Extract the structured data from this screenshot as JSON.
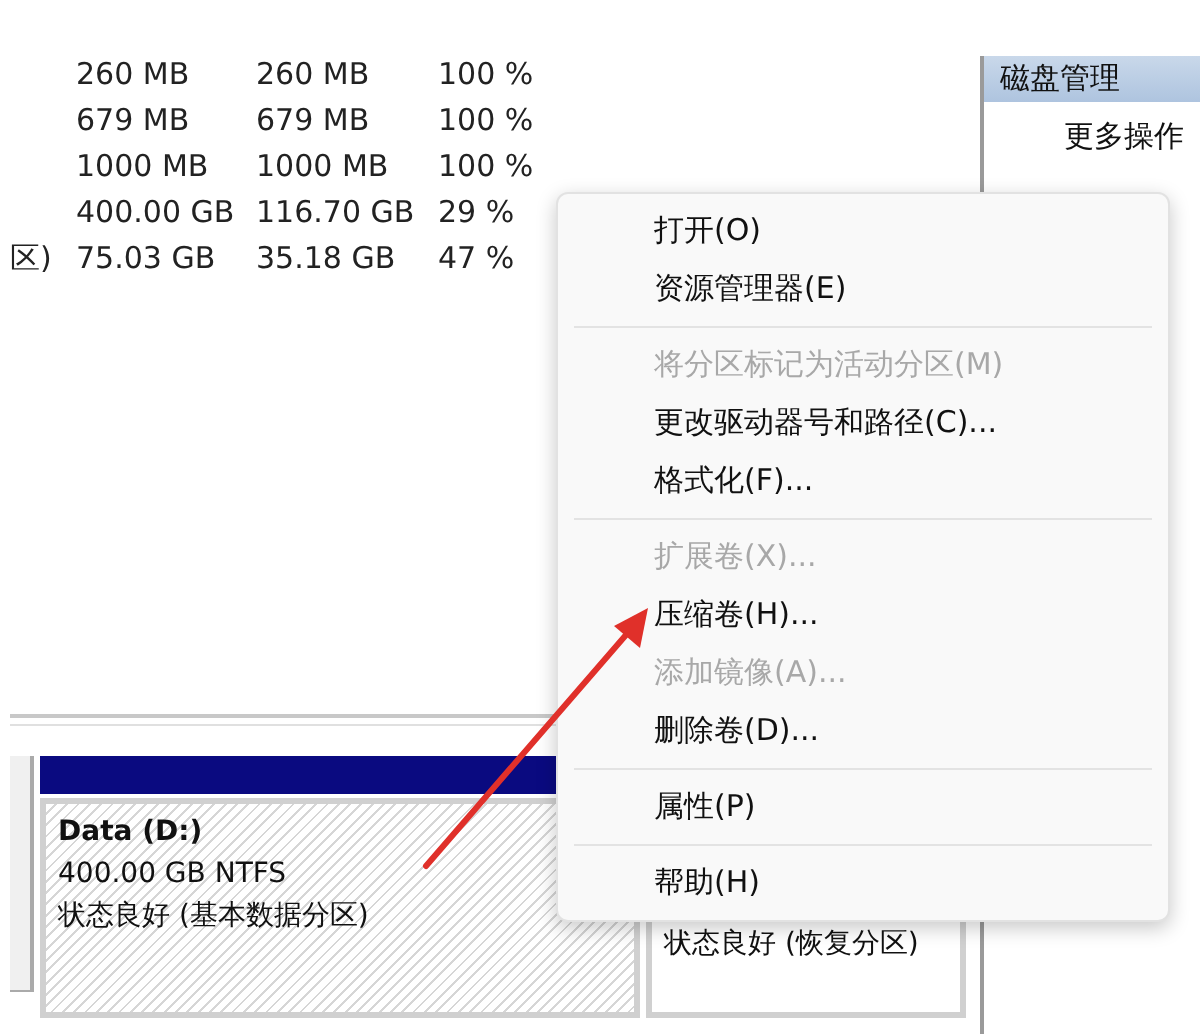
{
  "volume_table": {
    "rows": [
      {
        "capacity": "260 MB",
        "free": "260 MB",
        "percent_free": "100 %"
      },
      {
        "capacity": "679 MB",
        "free": "679 MB",
        "percent_free": "100 %"
      },
      {
        "capacity": "1000 MB",
        "free": "1000 MB",
        "percent_free": "100 %"
      },
      {
        "capacity": "400.00 GB",
        "free": "116.70 GB",
        "percent_free": "29 %"
      },
      {
        "column_1": "区)",
        "capacity": "75.03 GB",
        "free": "35.18 GB",
        "percent_free": "47 %"
      }
    ]
  },
  "actions_pane": {
    "header": "磁盘管理",
    "items": [
      "更多操作"
    ]
  },
  "disk_map": {
    "partitions": [
      {
        "name": "Data  (D:)",
        "size": "400.00 GB NTFS",
        "status": "状态良好 (基本数据分区)",
        "hatched": true
      },
      {
        "status": "状态良好 (恢复分区)",
        "hatched": false
      }
    ]
  },
  "context_menu": {
    "items": [
      {
        "kind": "item",
        "label": "打开(O)",
        "disabled": false
      },
      {
        "kind": "item",
        "label": "资源管理器(E)",
        "disabled": false
      },
      {
        "kind": "separator"
      },
      {
        "kind": "item",
        "label": "将分区标记为活动分区(M)",
        "disabled": true
      },
      {
        "kind": "item",
        "label": "更改驱动器号和路径(C)...",
        "disabled": false
      },
      {
        "kind": "item",
        "label": "格式化(F)...",
        "disabled": false
      },
      {
        "kind": "separator"
      },
      {
        "kind": "item",
        "label": "扩展卷(X)...",
        "disabled": true
      },
      {
        "kind": "item",
        "label": "压缩卷(H)...",
        "disabled": false
      },
      {
        "kind": "item",
        "label": "添加镜像(A)...",
        "disabled": true
      },
      {
        "kind": "item",
        "label": "删除卷(D)...",
        "disabled": false
      },
      {
        "kind": "separator"
      },
      {
        "kind": "item",
        "label": "属性(P)",
        "disabled": false
      },
      {
        "kind": "separator"
      },
      {
        "kind": "item",
        "label": "帮助(H)",
        "disabled": false
      }
    ]
  },
  "annotation": {
    "kind": "arrow"
  }
}
